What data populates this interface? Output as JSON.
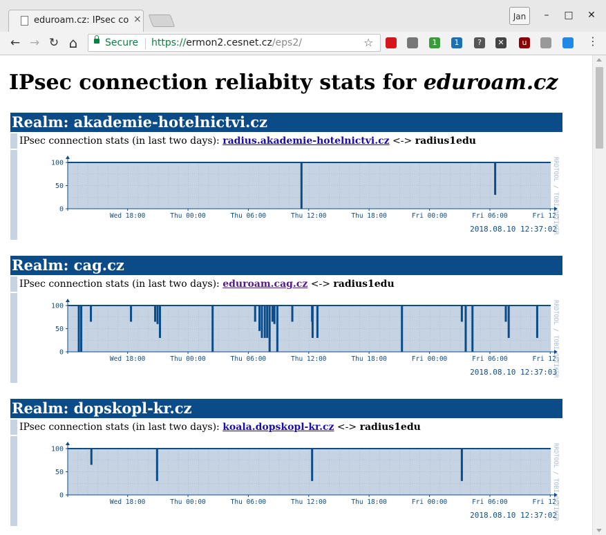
{
  "browser": {
    "tab_title": "eduroam.cz: IPsec co",
    "profile": "Jan",
    "secure_label": "Secure",
    "url_scheme": "https://",
    "url_host": "ermon2.cesnet.cz",
    "url_path": "/eps2/",
    "minimize": "–",
    "maximize": "□",
    "close": "✕",
    "back": "←",
    "forward": "→",
    "reload": "↻",
    "home": "⌂",
    "star": "☆",
    "menu": "⋮",
    "tab_close": "×",
    "extensions": [
      {
        "name": "czech-flag-icon",
        "color": "#d7141a",
        "text": ""
      },
      {
        "name": "puzzle-extension-icon",
        "color": "#777777",
        "text": ""
      },
      {
        "name": "green-circle-extension-icon",
        "color": "#3a9b3a",
        "text": "1"
      },
      {
        "name": "t-extension-icon",
        "color": "#1b6fb5",
        "text": "1"
      },
      {
        "name": "question-extension-icon",
        "color": "#555555",
        "text": "?"
      },
      {
        "name": "x-circle-extension-icon",
        "color": "#444444",
        "text": "✕"
      },
      {
        "name": "ublock-icon",
        "color": "#8b0000",
        "text": "u"
      },
      {
        "name": "grey-extension-icon",
        "color": "#999999",
        "text": ""
      },
      {
        "name": "blue-circle-extension-icon",
        "color": "#1e88e5",
        "text": ""
      }
    ]
  },
  "page": {
    "heading_prefix": "IPsec connection reliabity stats for ",
    "heading_domain": "eduroam.cz",
    "realms": [
      {
        "header": "Realm: akademie-hotelnictvi.cz",
        "stat_prefix": "IPsec connection stats (in last two days): ",
        "host": "radius.akademie-hotelnictvi.cz",
        "separator": " <-> ",
        "peer": "radius1edu",
        "host_visited": false,
        "timestamp": "2018.08.10 12:37:02",
        "dips": [
          [
            0.484,
            0
          ],
          [
            0.885,
            30
          ]
        ]
      },
      {
        "header": "Realm: cag.cz",
        "stat_prefix": "IPsec connection stats (in last two days): ",
        "host": "eduroam.cag.cz",
        "separator": " <-> ",
        "peer": "radius1edu",
        "host_visited": true,
        "timestamp": "2018.08.10 12:37:03",
        "dips": [
          [
            0.023,
            0
          ],
          [
            0.028,
            0
          ],
          [
            0.048,
            65
          ],
          [
            0.131,
            65
          ],
          [
            0.181,
            65
          ],
          [
            0.186,
            60
          ],
          [
            0.191,
            30
          ],
          [
            0.3,
            0
          ],
          [
            0.388,
            65
          ],
          [
            0.397,
            45
          ],
          [
            0.402,
            30
          ],
          [
            0.408,
            30
          ],
          [
            0.413,
            30
          ],
          [
            0.418,
            0
          ],
          [
            0.424,
            65
          ],
          [
            0.428,
            60
          ],
          [
            0.434,
            0
          ],
          [
            0.465,
            65
          ],
          [
            0.506,
            65
          ],
          [
            0.507,
            30
          ],
          [
            0.517,
            30
          ],
          [
            0.692,
            0
          ],
          [
            0.816,
            65
          ],
          [
            0.824,
            0
          ],
          [
            0.838,
            0
          ],
          [
            0.907,
            65
          ],
          [
            0.913,
            30
          ],
          [
            0.972,
            30
          ]
        ]
      },
      {
        "header": "Realm: dopskopl-kr.cz",
        "stat_prefix": "IPsec connection stats (in last two days): ",
        "host": "koala.dopskopl-kr.cz",
        "separator": " <-> ",
        "peer": "radius1edu",
        "host_visited": false,
        "timestamp": "2018.08.10 12:37:02",
        "dips": [
          [
            0.049,
            65
          ],
          [
            0.185,
            30
          ],
          [
            0.506,
            30
          ],
          [
            0.816,
            30
          ]
        ]
      }
    ]
  },
  "graph": {
    "y_ticks": [
      "100",
      "50",
      "0"
    ],
    "x_ticks": [
      "Wed 18:00",
      "Thu 00:00",
      "Thu 06:00",
      "Thu 12:00",
      "Thu 18:00",
      "Fri 00:00",
      "Fri 06:00",
      "Fri 12:00"
    ],
    "watermark": "RRDTOOL / TOBI OETIKER"
  }
}
